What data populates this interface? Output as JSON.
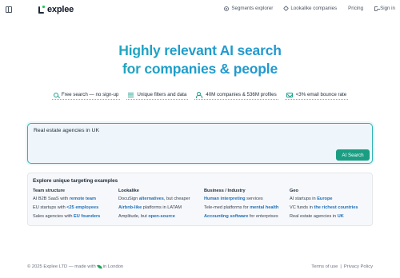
{
  "header": {
    "logo_text": "explee",
    "nav": [
      {
        "label": "Segments explorer",
        "icon": "target-icon"
      },
      {
        "label": "Lookalike companies",
        "icon": "tag-icon"
      },
      {
        "label": "Pricing",
        "icon": ""
      },
      {
        "label": "Sign in",
        "icon": "sign-in-icon"
      }
    ]
  },
  "hero": {
    "line1": "Highly relevant AI search",
    "line2": "for companies & people",
    "gradient": [
      "#25b6a6",
      "#2a8fd6"
    ]
  },
  "features": [
    {
      "label": "Free search — no sign-up",
      "icon": "search-icon"
    },
    {
      "label": "Unique filters and data",
      "icon": "filter-icon"
    },
    {
      "label": "40M companies & 536M profiles",
      "icon": "people-icon"
    },
    {
      "label": "<3% email bounce rate",
      "icon": "mail-icon"
    }
  ],
  "search": {
    "value": "Real estate agencies in UK",
    "button_label": "AI Search",
    "button_color": "#1a9e83",
    "border_color": "#2fb5b5"
  },
  "examples": {
    "title": "Explore unique targeting examples",
    "columns": [
      {
        "header": "Team structure",
        "items": [
          [
            {
              "t": "AI B2B SaaS with ",
              "h": false
            },
            {
              "t": "remote team",
              "h": true
            }
          ],
          [
            {
              "t": "EU startups with ",
              "h": false
            },
            {
              "t": "<25 employees",
              "h": true
            }
          ],
          [
            {
              "t": "Sales agencies with ",
              "h": false
            },
            {
              "t": "EU founders",
              "h": true
            }
          ]
        ]
      },
      {
        "header": "Lookalike",
        "items": [
          [
            {
              "t": "DocuSign ",
              "h": false
            },
            {
              "t": "alternatives",
              "h": true
            },
            {
              "t": ", but cheaper",
              "h": false
            }
          ],
          [
            {
              "t": "Airbnb-like",
              "h": true
            },
            {
              "t": " platforms in LATAM",
              "h": false
            }
          ],
          [
            {
              "t": "Amplitude, but ",
              "h": false
            },
            {
              "t": "open-source",
              "h": true
            }
          ]
        ]
      },
      {
        "header": "Business / Industry",
        "items": [
          [
            {
              "t": "Human interpreting",
              "h": true
            },
            {
              "t": " services",
              "h": false
            }
          ],
          [
            {
              "t": "Tele-med platforms for ",
              "h": false
            },
            {
              "t": "mental health",
              "h": true
            }
          ],
          [
            {
              "t": "Accounting software",
              "h": true
            },
            {
              "t": " for enterprises",
              "h": false
            }
          ]
        ]
      },
      {
        "header": "Geo",
        "items": [
          [
            {
              "t": "AI startups in ",
              "h": false
            },
            {
              "t": "Europe",
              "h": true
            }
          ],
          [
            {
              "t": "VC funds in ",
              "h": false
            },
            {
              "t": "the richest countries",
              "h": true
            }
          ],
          [
            {
              "t": "Real estate agencies in ",
              "h": false
            },
            {
              "t": "UK",
              "h": true
            }
          ]
        ]
      }
    ]
  },
  "footer": {
    "copyright_pre": "© 2025 Explee LTD — made with",
    "copyright_post": "in London",
    "terms": "Terms of use",
    "separator": "|",
    "privacy": "Privacy Policy"
  }
}
